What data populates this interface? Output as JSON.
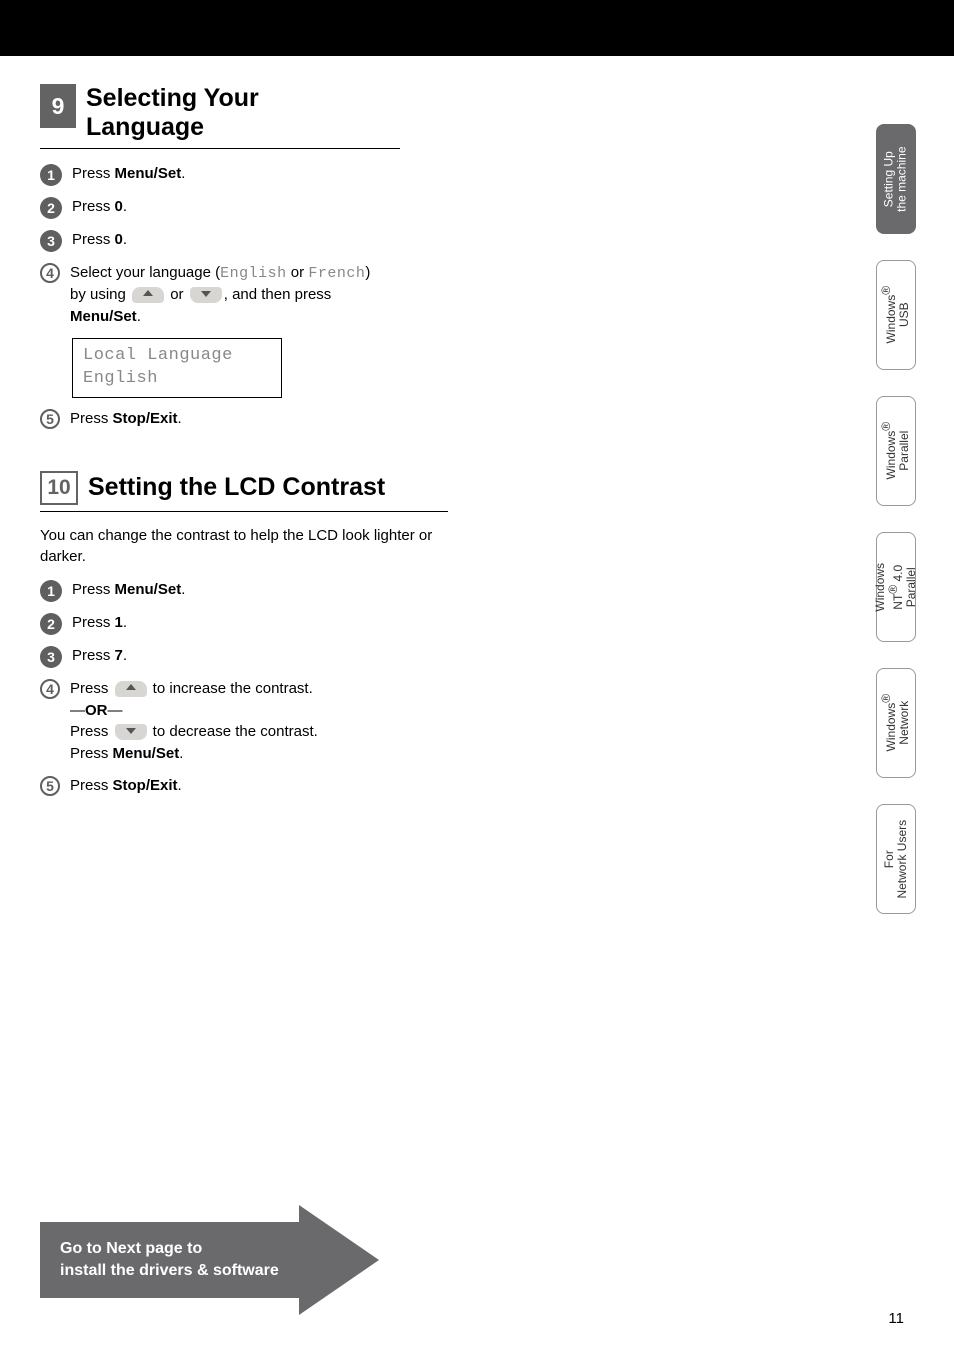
{
  "section9": {
    "number": "9",
    "title_line1": "Selecting Your",
    "title_line2": "Language",
    "steps": {
      "s1": "Press ",
      "s1b": "Menu/Set",
      "s1end": ".",
      "s2": "Press ",
      "s2b": "0",
      "s2end": ".",
      "s3": "Press ",
      "s3b": "0",
      "s3end": ".",
      "s4a": "Select your language (",
      "s4lang1": "English",
      "s4or": " or ",
      "s4lang2": "French",
      "s4b": ")",
      "s4c": "by using ",
      "s4d": " or ",
      "s4e": ", and then press",
      "s4f": "Menu/Set",
      "s4fend": ".",
      "lcd1": "Local Language",
      "lcd2": "English",
      "s5": "Press ",
      "s5b": "Stop/Exit",
      "s5end": "."
    }
  },
  "section10": {
    "number": "10",
    "title": "Setting the LCD Contrast",
    "intro": "You can change the contrast to help the LCD look lighter or darker.",
    "steps": {
      "s1": "Press ",
      "s1b": "Menu/Set",
      "s1end": ".",
      "s2": "Press ",
      "s2b": "1",
      "s2end": ".",
      "s3": "Press ",
      "s3b": "7",
      "s3end": ".",
      "s4a": "Press ",
      "s4b": " to increase the contrast.",
      "s4or1": "—",
      "s4or2": "OR",
      "s4or3": "—",
      "s4c": "Press ",
      "s4d": " to decrease the contrast.",
      "s4e": "Press ",
      "s4f": "Menu/Set",
      "s4fend": ".",
      "s5": "Press ",
      "s5b": "Stop/Exit",
      "s5end": "."
    }
  },
  "tabs": {
    "t1a": "Setting Up",
    "t1b": "the machine",
    "t2a": "Windows",
    "t2b": "USB",
    "t3a": "Windows",
    "t3b": "Parallel",
    "t4a": "Windows",
    "t4b": "NT",
    "t4c": " 4.0",
    "t4d": "Parallel",
    "t5a": "Windows",
    "t5b": "Network",
    "t6a": "For",
    "t6b": "Network Users"
  },
  "banner": {
    "line1": "Go to Next page to",
    "line2": "install the drivers & software"
  },
  "page_number": "11",
  "reg": "®"
}
